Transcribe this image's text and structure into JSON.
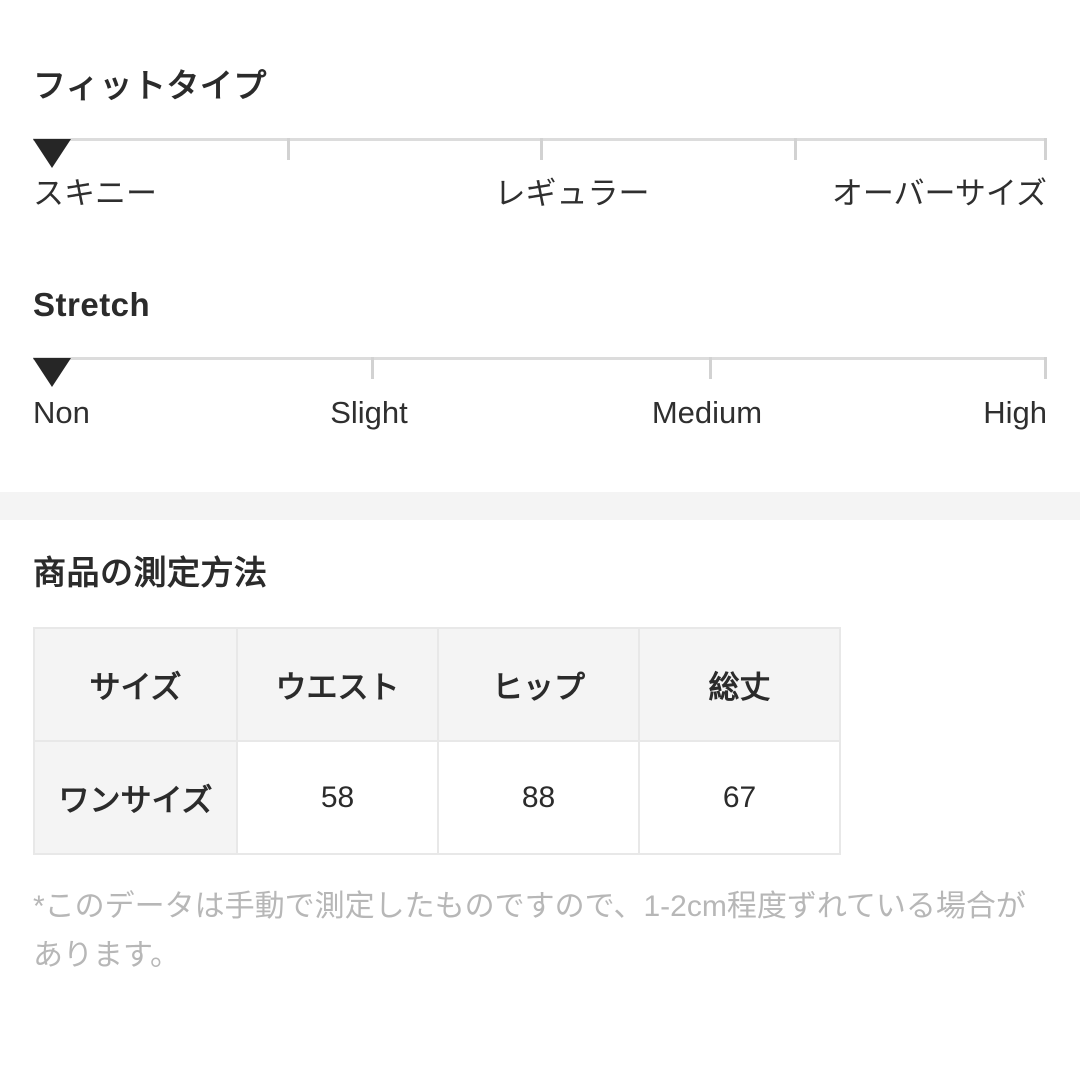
{
  "fit_type": {
    "heading": "フィットタイプ",
    "marker_position_percent": 0,
    "stops": 4,
    "labels": [
      {
        "text": "スキニー",
        "align": "left"
      },
      {
        "text": "レギュラー",
        "align": "center"
      },
      {
        "text": "オーバーサイズ",
        "align": "right"
      }
    ]
  },
  "stretch": {
    "heading": "Stretch",
    "marker_position_percent": 0,
    "stops": 4,
    "labels": [
      {
        "text": "Non",
        "align": "left"
      },
      {
        "text": "Slight",
        "align": "center"
      },
      {
        "text": "Medium",
        "align": "center"
      },
      {
        "text": "High",
        "align": "right"
      }
    ]
  },
  "measurement": {
    "heading": "商品の測定方法",
    "columns": [
      "サイズ",
      "ウエスト",
      "ヒップ",
      "総丈"
    ],
    "rows": [
      {
        "size": "ワンサイズ",
        "values": [
          "58",
          "88",
          "67"
        ]
      }
    ],
    "footnote": "*このデータは手動で測定したものですので、1-2cm程度ずれている場合があります。"
  },
  "colors": {
    "background": "#ffffff",
    "text": "#2b2b2b",
    "muted_text": "#b7b7b7",
    "rule": "#dcdcdc",
    "tick": "#d2d2d2",
    "marker": "#262626",
    "band": "#f4f4f4",
    "table_border": "#e8e8e8"
  }
}
